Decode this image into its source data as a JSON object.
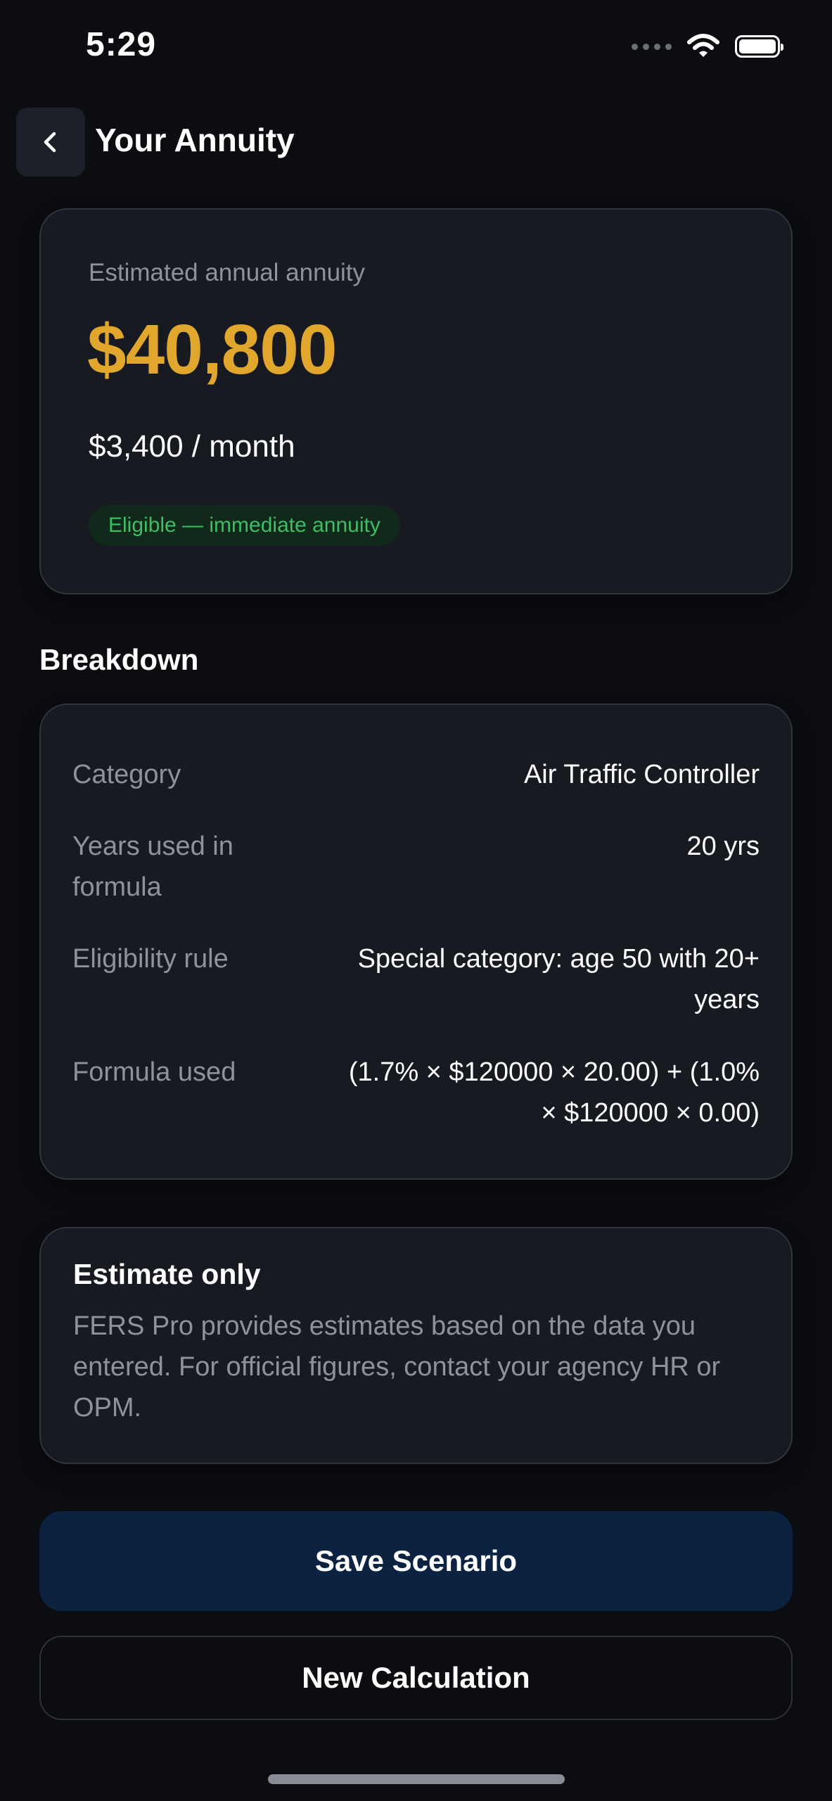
{
  "status_bar": {
    "time": "5:29",
    "icons": [
      "signal-dots-icon",
      "wifi-icon",
      "battery-icon"
    ]
  },
  "header": {
    "back_icon": "chevron-left-icon",
    "title": "Your Annuity"
  },
  "annuity": {
    "label": "Estimated annual annuity",
    "amount": "$40,800",
    "monthly": "$3,400 / month",
    "badge": "Eligible — immediate annuity"
  },
  "breakdown": {
    "title": "Breakdown",
    "rows": [
      {
        "label": "Category",
        "value": "Air Traffic Controller"
      },
      {
        "label": "Years used in formula",
        "value": "20 yrs"
      },
      {
        "label": "Eligibility rule",
        "value": "Special category: age 50 with 20+ years"
      },
      {
        "label": "Formula used",
        "value": "(1.7% × $120000 × 20.00) + (1.0% × $120000 × 0.00)"
      }
    ]
  },
  "disclaimer": {
    "title": "Estimate only",
    "text": "FERS Pro provides estimates based on the data you entered. For official figures, contact your agency HR or OPM."
  },
  "actions": {
    "save_label": "Save Scenario",
    "new_calc_label": "New Calculation"
  },
  "colors": {
    "background": "#0c0d11",
    "card": "#181a21",
    "accent_gold": "#e0a72c",
    "success_green": "#3fbd63",
    "primary_button": "#0b2340"
  }
}
